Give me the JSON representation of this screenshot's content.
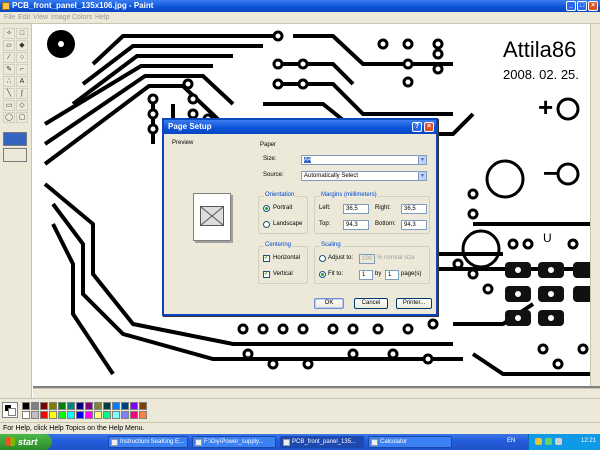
{
  "window": {
    "title": "PCB_front_panel_135x106.jpg - Paint",
    "min": "_",
    "max": "□",
    "close": "×"
  },
  "menu": [
    "File",
    "Edit",
    "View",
    "Image",
    "Colors",
    "Help"
  ],
  "toolbox": {
    "tools": [
      "free-select",
      "select",
      "eraser",
      "fill",
      "color-picker",
      "magnifier",
      "pencil",
      "brush",
      "airbrush",
      "text",
      "line",
      "curve",
      "rectangle",
      "polygon",
      "ellipse",
      "rounded-rectangle"
    ]
  },
  "canvas": {
    "pcb_text_1": "Attila86",
    "pcb_text_2": "2008. 02. 25.",
    "plus_sign": "+",
    "minus_sign": "−",
    "u_label": "U"
  },
  "palette": {
    "colors": [
      "#000000",
      "#808080",
      "#800000",
      "#808000",
      "#008000",
      "#008080",
      "#000080",
      "#800080",
      "#808040",
      "#004040",
      "#0080ff",
      "#004080",
      "#8000ff",
      "#804000",
      "#ffffff",
      "#c0c0c0",
      "#ff0000",
      "#ffff00",
      "#00ff00",
      "#00ffff",
      "#0000ff",
      "#ff00ff",
      "#ffff80",
      "#00ff80",
      "#80ffff",
      "#8080ff",
      "#ff0080",
      "#ff8040"
    ]
  },
  "status": "For Help, click Help Topics on the Help Menu.",
  "taskbar": {
    "start": "start",
    "tasks": [
      "Instructiuni SeaKing E...",
      "F:\\Diy\\Power_supply...",
      "PCB_front_panel_135...",
      "Calculator"
    ],
    "lang": "EN",
    "clock": "12:21"
  },
  "dialog": {
    "title": "Page Setup",
    "help": "?",
    "close": "×",
    "preview_label": "Preview",
    "paper_label": "Paper",
    "size_label": "Size:",
    "size_value": "A4",
    "source_label": "Source:",
    "source_value": "Automatically Select",
    "orientation_label": "Orientation",
    "portrait": "Portrait",
    "landscape": "Landscape",
    "margins_label": "Margins (millimeters)",
    "left_label": "Left:",
    "left_value": "36,5",
    "right_label": "Right:",
    "right_value": "36,5",
    "top_label": "Top:",
    "top_value": "94,3",
    "bottom_label": "Bottom:",
    "bottom_value": "94,3",
    "centering_label": "Centering",
    "horizontal": "Horizontal",
    "vertical": "Vertical",
    "scaling_label": "Scaling",
    "adjust_to": "Adjust to:",
    "adjust_value": "100",
    "adjust_suffix": "% normal size",
    "fit_to": "Fit to:",
    "fit_w": "1",
    "fit_by": "by",
    "fit_h": "1",
    "fit_suffix": "page(s)",
    "ok": "OK",
    "cancel": "Cancel",
    "printer": "Printer..."
  }
}
